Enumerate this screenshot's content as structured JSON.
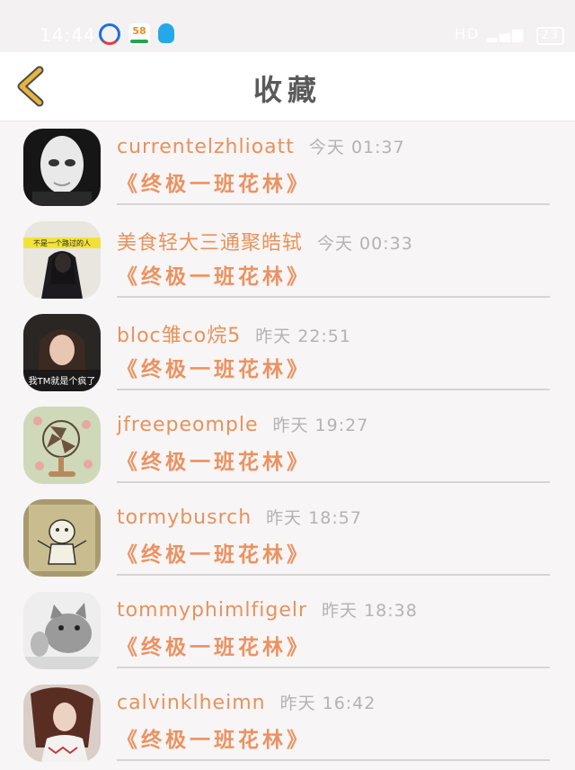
{
  "status_bar": {
    "time": "14:44",
    "app_icon_58_label": "58",
    "network_text": "HD",
    "battery": "23"
  },
  "header": {
    "title": "收藏"
  },
  "favorites": [
    {
      "username": "currentelzhlioatt",
      "time": "今天 01:37",
      "title": "《终极一班花林》"
    },
    {
      "username": "美食轻大三通聚皓轼",
      "time": "今天 00:33",
      "title": "《终极一班花林》"
    },
    {
      "username": "bloc雏co烷5",
      "time": "昨天 22:51",
      "title": "《终极一班花林》"
    },
    {
      "username": "jfreepeomple",
      "time": "昨天 19:27",
      "title": "《终极一班花林》"
    },
    {
      "username": "tormybusrch",
      "time": "昨天 18:57",
      "title": "《终极一班花林》"
    },
    {
      "username": "tommyphimlfigelr",
      "time": "昨天 18:38",
      "title": "《终极一班花林》"
    },
    {
      "username": "calvinklheimn",
      "time": "昨天 16:42",
      "title": "《终极一班花林》"
    }
  ],
  "avatar_text": {
    "row2": "不是一个路过的人",
    "row3": "我TM就是个疯了"
  },
  "colors": {
    "accent": "#ec9260",
    "back_arrow": "#e7b53d",
    "time_gray": "#b4b2b3",
    "title_gray": "#5a5a5a"
  }
}
